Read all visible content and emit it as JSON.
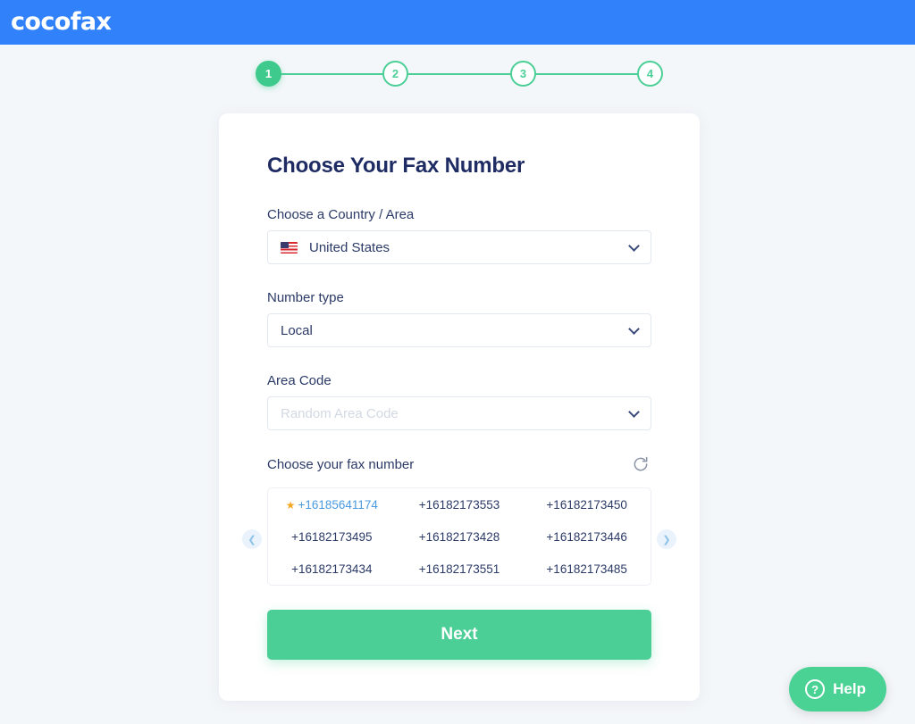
{
  "colors": {
    "header_blue": "#3182fa",
    "accent_green": "#4ccf97",
    "title_navy": "#1f2c64",
    "selected_blue": "#4a9ae0",
    "star_orange": "#f5a623",
    "page_bg": "#f4f7fa"
  },
  "header": {
    "brand": "cocofax"
  },
  "stepper": {
    "steps": [
      {
        "label": "1",
        "state": "active"
      },
      {
        "label": "2",
        "state": "inactive"
      },
      {
        "label": "3",
        "state": "inactive"
      },
      {
        "label": "4",
        "state": "inactive"
      }
    ]
  },
  "card": {
    "title": "Choose Your Fax Number",
    "fields": {
      "country": {
        "label": "Choose a Country / Area",
        "value": "United States",
        "icon": "us-flag-icon"
      },
      "number_type": {
        "label": "Number type",
        "value": "Local"
      },
      "area_code": {
        "label": "Area Code",
        "placeholder": "Random Area Code",
        "value": ""
      }
    },
    "fax_chooser": {
      "label": "Choose your fax number",
      "refresh_icon": "refresh-icon",
      "prev_icon": "chevron-left-icon",
      "next_icon": "chevron-right-icon",
      "star_glyph": "★",
      "numbers": [
        {
          "value": "+16185641174",
          "selected": true
        },
        {
          "value": "+16182173553",
          "selected": false
        },
        {
          "value": "+16182173450",
          "selected": false
        },
        {
          "value": "+16182173495",
          "selected": false
        },
        {
          "value": "+16182173428",
          "selected": false
        },
        {
          "value": "+16182173446",
          "selected": false
        },
        {
          "value": "+16182173434",
          "selected": false
        },
        {
          "value": "+16182173551",
          "selected": false
        },
        {
          "value": "+16182173485",
          "selected": false
        }
      ]
    },
    "next_button": "Next"
  },
  "help_widget": {
    "label": "Help",
    "icon": "question-mark-icon",
    "icon_glyph": "?"
  }
}
